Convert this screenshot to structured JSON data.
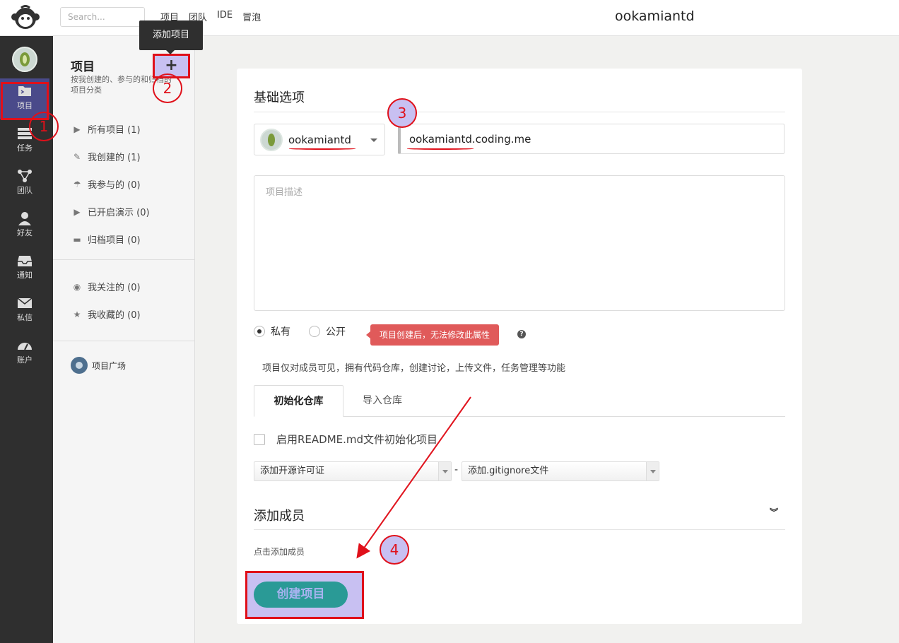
{
  "header": {
    "search_placeholder": "Search...",
    "nav": [
      "项目",
      "团队",
      "IDE",
      "冒泡"
    ],
    "username": "ookamiantd"
  },
  "sidebar": {
    "items": [
      {
        "label": "项目",
        "icon": "folder-icon"
      },
      {
        "label": "任务",
        "icon": "tasks-icon"
      },
      {
        "label": "团队",
        "icon": "team-icon"
      },
      {
        "label": "好友",
        "icon": "user-icon"
      },
      {
        "label": "通知",
        "icon": "inbox-icon"
      },
      {
        "label": "私信",
        "icon": "mail-icon"
      },
      {
        "label": "账户",
        "icon": "dashboard-icon"
      }
    ]
  },
  "subpanel": {
    "title": "项目",
    "desc": "按我创建的、参与的和归档的项目分类",
    "add_label": "+",
    "tooltip": "添加项目",
    "items": [
      {
        "label": "所有项目 (1)",
        "icon": "folder-icon"
      },
      {
        "label": "我创建的 (1)",
        "icon": "edit-icon"
      },
      {
        "label": "我参与的 (0)",
        "icon": "umbrella-icon"
      },
      {
        "label": "已开启演示 (0)",
        "icon": "play-icon"
      },
      {
        "label": "归档项目 (0)",
        "icon": "archive-icon"
      }
    ],
    "items2": [
      {
        "label": "我关注的 (0)",
        "icon": "eye-icon"
      },
      {
        "label": "我收藏的 (0)",
        "icon": "star-icon"
      }
    ],
    "plaza": "项目广场"
  },
  "form": {
    "section_basic": "基础选项",
    "owner": "ookamiantd",
    "project_name": "ookamiantd.coding.me",
    "desc_placeholder": "项目描述",
    "private_label": "私有",
    "public_label": "公开",
    "warn": "项目创建后，无法修改此属性",
    "help": "?",
    "info": "项目仅对成员可见，拥有代码仓库，创建讨论，上传文件，任务管理等功能",
    "tab_init": "初始化仓库",
    "tab_import": "导入仓库",
    "readme_label": "启用README.md文件初始化项目",
    "license_placeholder": "添加开源许可证",
    "gitignore_placeholder": "添加.gitignore文件",
    "dash": "-",
    "section_members": "添加成员",
    "members_hint": "点击添加成员",
    "create_label": "创建项目"
  },
  "annotations": {
    "n1": "1",
    "n2": "2",
    "n3": "3",
    "n4": "4"
  },
  "colors": {
    "accent_red": "#e0101a",
    "highlight": "#c8c0f2",
    "create_button": "#2a9a96",
    "warn": "#e05a5a"
  }
}
